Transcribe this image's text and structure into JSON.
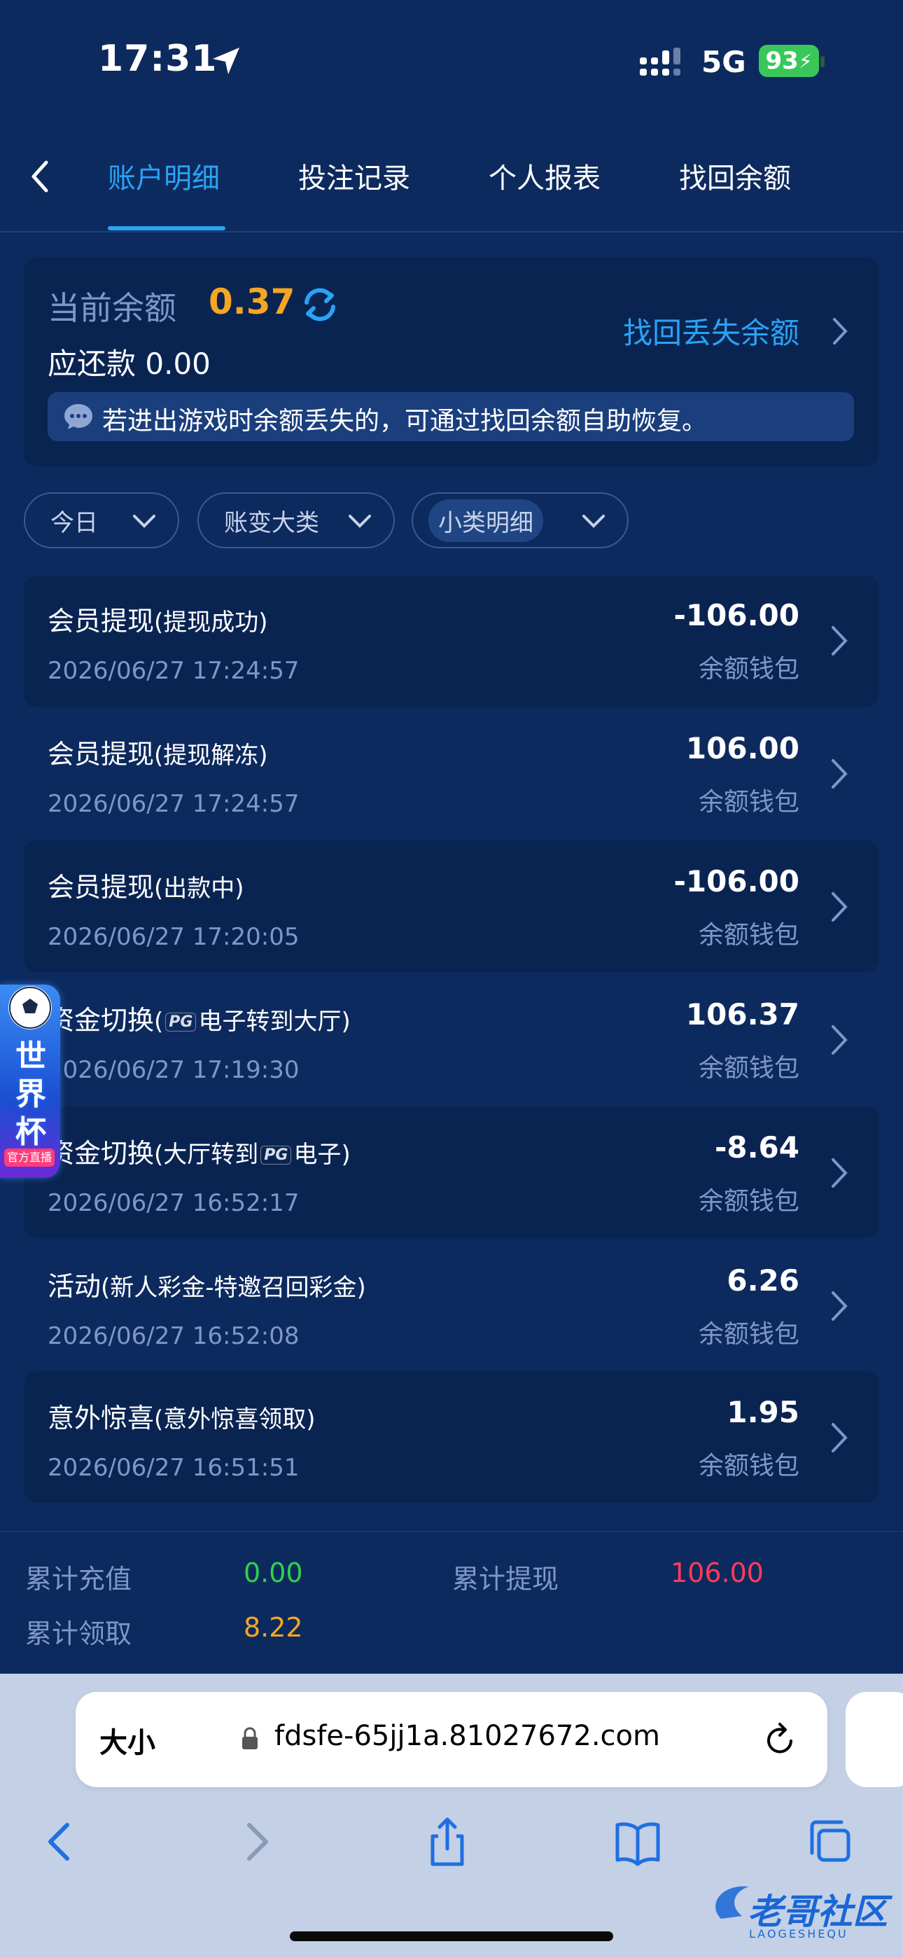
{
  "status_bar": {
    "time": "17:31",
    "network": "5G",
    "battery": "93"
  },
  "header": {
    "tabs": [
      {
        "label": "账户明细",
        "active": true
      },
      {
        "label": "投注记录",
        "active": false
      },
      {
        "label": "个人报表",
        "active": false
      },
      {
        "label": "找回余额",
        "active": false
      }
    ]
  },
  "balance": {
    "label": "当前余额",
    "value": "0.37",
    "due_label": "应还款",
    "due_value": "0.00",
    "recover_link": "找回丢失余额",
    "notice": "若进出游戏时余额丢失的，可通过找回余额自助恢复。"
  },
  "filters": [
    {
      "label": "今日"
    },
    {
      "label": "账变大类"
    },
    {
      "label": "小类明细"
    }
  ],
  "transactions": [
    {
      "title": "会员提现",
      "sub": "(提现成功)",
      "date": "2026/06/27 17:24:57",
      "amount": "-106.00",
      "wallet": "余额钱包"
    },
    {
      "title": "会员提现",
      "sub": "(提现解冻)",
      "date": "2026/06/27 17:24:57",
      "amount": "106.00",
      "wallet": "余额钱包"
    },
    {
      "title": "会员提现",
      "sub": "(出款中)",
      "date": "2026/06/27 17:20:05",
      "amount": "-106.00",
      "wallet": "余额钱包"
    },
    {
      "title": "资金切换",
      "sub_pre": "(",
      "sub_pg": "PG",
      "sub_post": "电子转到大厅)",
      "date": "2026/06/27 17:19:30",
      "amount": "106.37",
      "wallet": "余额钱包"
    },
    {
      "title": "资金切换",
      "sub_pre": "(大厅转到",
      "sub_pg": "PG",
      "sub_post": "电子)",
      "date": "2026/06/27 16:52:17",
      "amount": "-8.64",
      "wallet": "余额钱包"
    },
    {
      "title": "活动",
      "sub": "(新人彩金-特邀召回彩金)",
      "date": "2026/06/27 16:52:08",
      "amount": "6.26",
      "wallet": "余额钱包"
    },
    {
      "title": "意外惊喜",
      "sub": "(意外惊喜领取)",
      "date": "2026/06/27 16:51:51",
      "amount": "1.95",
      "wallet": "余额钱包"
    }
  ],
  "totals": {
    "recharge_label": "累计充值",
    "recharge_value": "0.00",
    "withdraw_label": "累计提现",
    "withdraw_value": "106.00",
    "claim_label": "累计领取",
    "claim_value": "8.22"
  },
  "browser": {
    "text_size": "大小",
    "url": "fdsfe-65jj1a.81027672.com"
  },
  "floating_badge": {
    "text": "世界杯",
    "tag": "官方直播"
  },
  "watermark": {
    "text": "老哥社区",
    "sub": "LAOGESHEQU"
  },
  "colors": {
    "background": "#0d2a5e",
    "card": "#0a2452",
    "accent": "#2aa3f5",
    "balance": "#f5a623",
    "positive": "#2fd24b",
    "negative": "#ff3b5c"
  }
}
